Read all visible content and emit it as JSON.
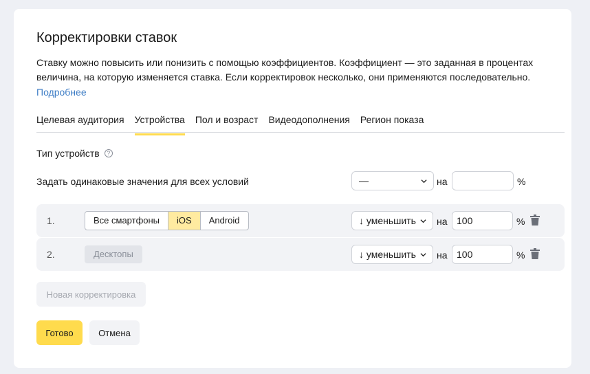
{
  "dialog": {
    "title": "Корректировки ставок",
    "description": "Ставку можно повысить или понизить с помощью коэффициентов. Коэффициент — это заданная в процентах величина, на которую изменяется ставка. Если корректировок несколько, они применяются последовательно.",
    "more_link": "Подробнее"
  },
  "tabs": [
    {
      "label": "Целевая аудитория",
      "active": false
    },
    {
      "label": "Устройства",
      "active": true
    },
    {
      "label": "Пол и возраст",
      "active": false
    },
    {
      "label": "Видеодополнения",
      "active": false
    },
    {
      "label": "Регион показа",
      "active": false
    }
  ],
  "device_type_label": "Тип устройств",
  "help_icon_glyph": "?",
  "same_values": {
    "label": "Задать одинаковые значения для всех условий",
    "select_value": "—",
    "on_label": "на",
    "input_value": "",
    "percent": "%"
  },
  "rows": [
    {
      "number": "1.",
      "segments": [
        "Все смартфоны",
        "iOS",
        "Android"
      ],
      "selected_segment": "iOS",
      "select_value": "↓ уменьшить",
      "on_label": "на",
      "input_value": "100",
      "percent": "%"
    },
    {
      "number": "2.",
      "chip": "Десктопы",
      "select_value": "↓ уменьшить",
      "on_label": "на",
      "input_value": "100",
      "percent": "%"
    }
  ],
  "buttons": {
    "new_adjustment": "Новая корректировка",
    "done": "Готово",
    "cancel": "Отмена"
  },
  "colors": {
    "accent": "#ffdb4d",
    "link": "#3f7ec6",
    "selected_segment": "#ffeba0",
    "row_bg": "#f2f3f6",
    "page_bg": "#eef0f5"
  }
}
